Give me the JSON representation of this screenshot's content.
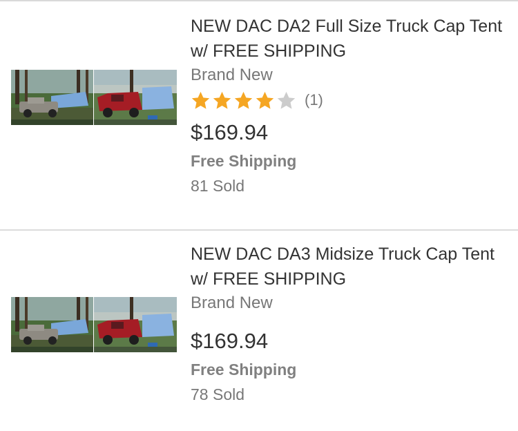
{
  "listings": [
    {
      "title": "NEW DAC DA2 Full Size Truck Cap Tent w/ FREE SHIPPING",
      "condition": "Brand New",
      "rating": 4,
      "rating_max": 5,
      "review_count": "(1)",
      "price": "$169.94",
      "shipping": "Free Shipping",
      "sold": "81 Sold"
    },
    {
      "title": "NEW DAC DA3 Midsize Truck Cap Tent w/ FREE SHIPPING",
      "condition": "Brand New",
      "price": "$169.94",
      "shipping": "Free Shipping",
      "sold": "78 Sold"
    }
  ],
  "colors": {
    "star_filled": "#f5a623",
    "star_empty": "#cccccc",
    "divider": "#d9d9d9"
  }
}
